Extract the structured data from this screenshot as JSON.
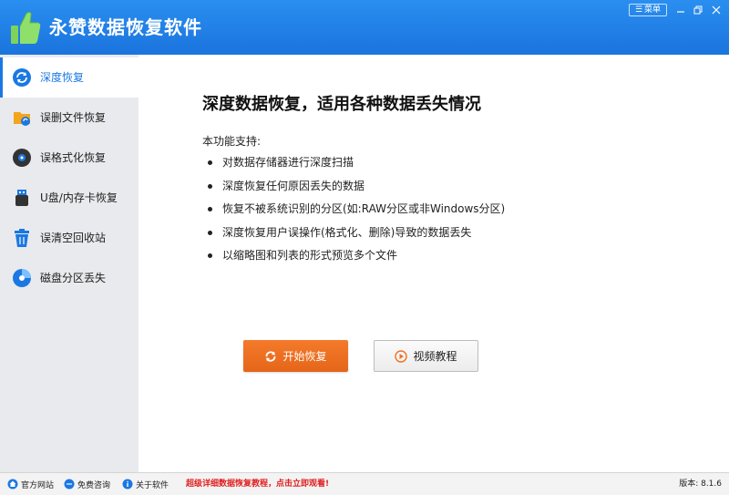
{
  "app": {
    "title": "永赞数据恢复软件",
    "menu_label": "菜单",
    "accent_color": "#1b78e2",
    "titlebar_color": "#1a74dd",
    "primary_button_color": "#f07020"
  },
  "sidebar": {
    "items": [
      {
        "label": "深度恢复",
        "icon": "refresh-icon",
        "active": true
      },
      {
        "label": "误删文件恢复",
        "icon": "folder-icon",
        "active": false
      },
      {
        "label": "误格式化恢复",
        "icon": "disk-icon",
        "active": false
      },
      {
        "label": "U盘/内存卡恢复",
        "icon": "usb-icon",
        "active": false
      },
      {
        "label": "误清空回收站",
        "icon": "recycle-bin-icon",
        "active": false
      },
      {
        "label": "磁盘分区丢失",
        "icon": "partition-icon",
        "active": false
      }
    ]
  },
  "main": {
    "heading": "深度数据恢复，适用各种数据丢失情况",
    "support_title": "本功能支持:",
    "features": [
      "对数据存储器进行深度扫描",
      "深度恢复任何原因丢失的数据",
      "恢复不被系统识别的分区(如:RAW分区或非Windows分区)",
      "深度恢复用户误操作(格式化、删除)导致的数据丢失",
      "以缩略图和列表的形式预览多个文件"
    ],
    "start_button": "开始恢复",
    "video_button": "视频教程"
  },
  "footer": {
    "official_site": "官方网站",
    "free_consult": "免费咨询",
    "about": "关于软件",
    "promo": "超级详细数据恢复教程，点击立即观看!",
    "version": "版本: 8.1.6"
  }
}
